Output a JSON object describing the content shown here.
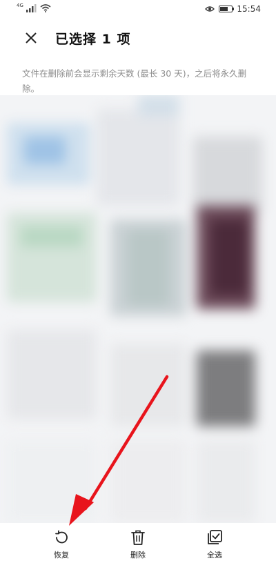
{
  "status_bar": {
    "network_type": "4G",
    "signal_icon": "signal-bars-icon",
    "wifi_icon": "wifi-icon",
    "eye_icon": "eye-comfort-icon",
    "battery_icon": "battery-icon",
    "time": "15:54"
  },
  "header": {
    "close_icon": "close-icon",
    "title": "已选择 1 项"
  },
  "notice": {
    "text": "文件在删除前会显示剩余天数 (最长 30 天)，之后将永久删除。"
  },
  "bottom_actions": [
    {
      "label": "恢复",
      "icon": "restore-icon"
    },
    {
      "label": "删除",
      "icon": "trash-icon"
    },
    {
      "label": "全选",
      "icon": "select-all-icon"
    }
  ],
  "colors": {
    "annotation_arrow": "#e8141c",
    "notice_text": "#8c8c8c"
  }
}
